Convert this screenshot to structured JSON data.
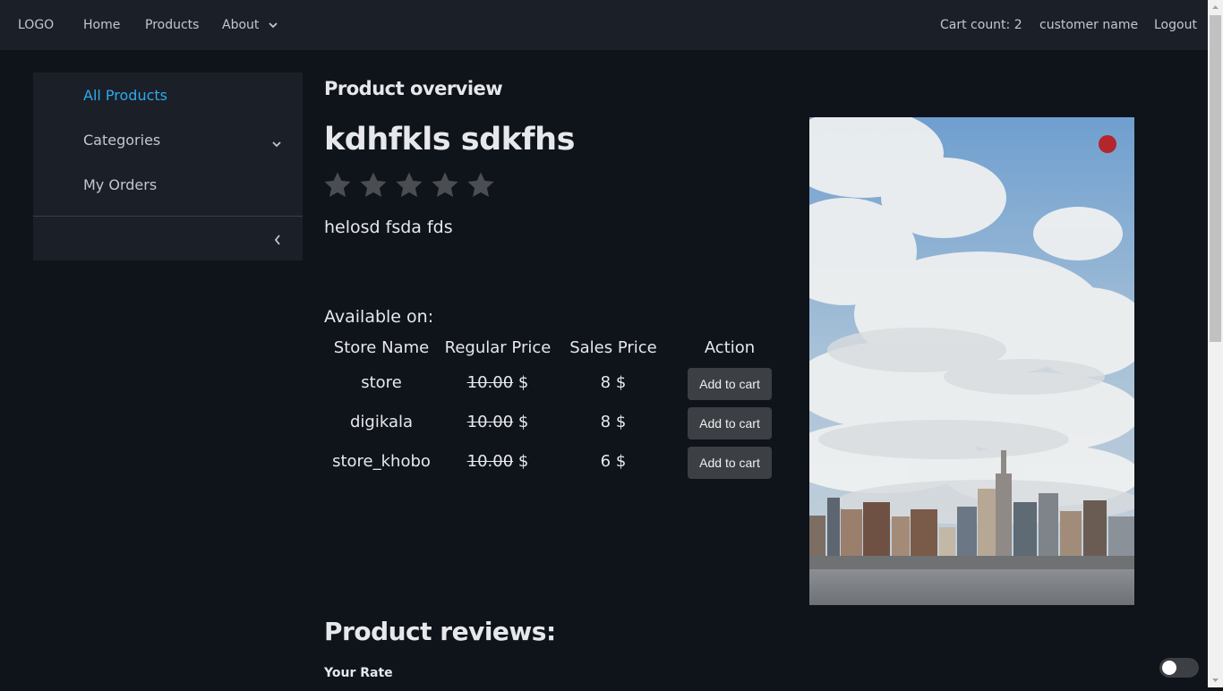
{
  "header": {
    "logo": "LOGO",
    "nav": {
      "home": "Home",
      "products": "Products",
      "about": "About"
    },
    "cart_count": "Cart count: 2",
    "customer_name": "customer name",
    "logout": "Logout"
  },
  "sidebar": {
    "items": [
      {
        "label": "All Products",
        "active": true
      },
      {
        "label": "Categories"
      },
      {
        "label": "My Orders"
      }
    ]
  },
  "product": {
    "overview_heading": "Product overview",
    "title": "kdhfkls sdkfhs",
    "rating": {
      "value": 0,
      "max": 5
    },
    "description": "helosd fsda fds",
    "available_on": "Available on:",
    "table": {
      "headers": [
        "Store Name",
        "Regular Price",
        "Sales Price",
        "Action"
      ],
      "rows": [
        {
          "store": "store",
          "regular": "10.00",
          "sales": "8",
          "currency": "$",
          "action": "Add to cart"
        },
        {
          "store": "digikala",
          "regular": "10.00",
          "sales": "8",
          "currency": "$",
          "action": "Add to cart"
        },
        {
          "store": "store_khobo",
          "regular": "10.00",
          "sales": "6",
          "currency": "$",
          "action": "Add to cart"
        }
      ]
    }
  },
  "reviews": {
    "heading": "Product reviews:",
    "your_rate": "Your Rate"
  },
  "theme": {
    "accent": "#2ea9ef",
    "favorite_dot": "#b3262b",
    "star_empty": "#4a4d52"
  }
}
